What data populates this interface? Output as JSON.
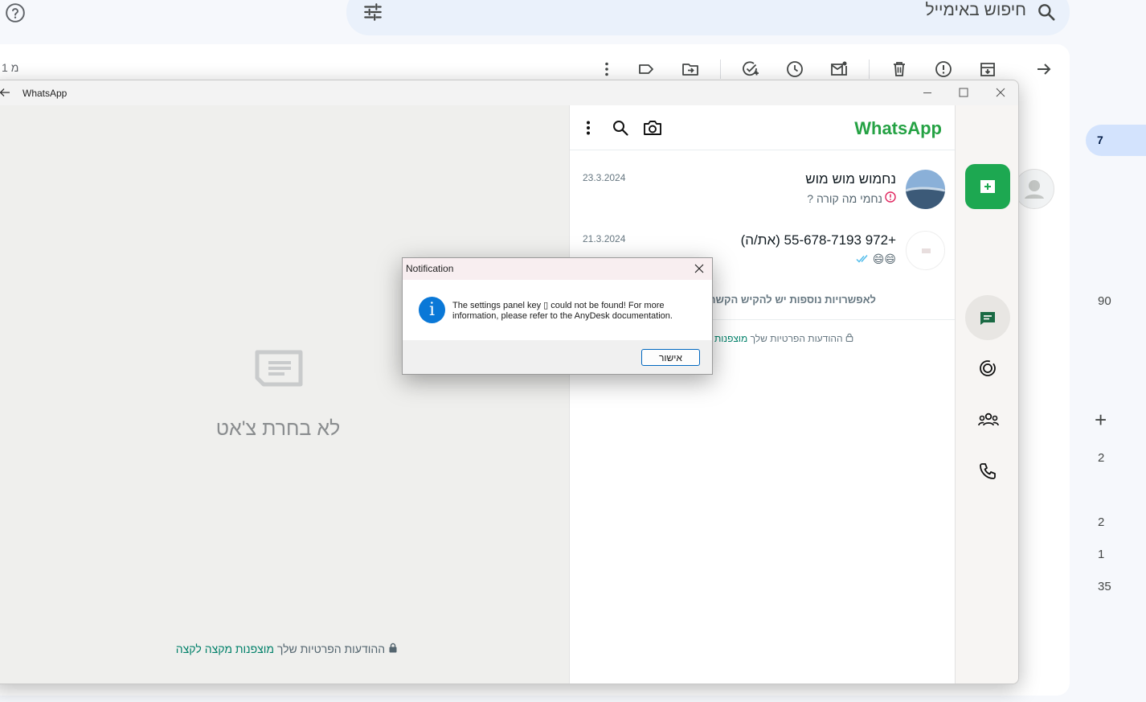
{
  "gmail": {
    "search_placeholder": "חיפוש באימייל",
    "count_label": "1 מ",
    "toolbar_icons": [
      "back-arrow-icon",
      "archive-icon",
      "report-spam-icon",
      "delete-icon",
      "mark-unread-icon",
      "snooze-icon",
      "add-to-tasks-icon",
      "move-to-icon",
      "label-icon",
      "more-vert-icon"
    ],
    "right_rail": {
      "active_count": "7",
      "counts": [
        "90",
        "2",
        "2",
        "1",
        "35"
      ]
    }
  },
  "whatsapp": {
    "window_title": "WhatsApp",
    "logo": "WhatsApp",
    "empty_state": "לא בחרת צ'אט",
    "encrypted_note_prefix": "ההודעות הפרטיות שלך",
    "encrypted_note_link": "מוצפנות מקצה לקצה",
    "encrypted_note_link_short": "מוצפנות",
    "more_options_note": "לאפשרויות נוספות יש להקיש הקשה א",
    "chats": [
      {
        "name": "נחמוש מוש מוש",
        "preview": "נחמי מה קורה ?",
        "date": "23.3.2024"
      },
      {
        "name": "+972 55-678-7193 (את/ה)",
        "preview": "😄😄",
        "date": "21.3.2024"
      }
    ],
    "colors": {
      "brand": "#25a244",
      "new_chat": "#1da851",
      "link": "#008069"
    }
  },
  "dialog": {
    "title": "Notification",
    "message": "The settings panel key ▯ could not be found! For more information, please refer to the AnyDesk documentation.",
    "ok_label": "אישור"
  }
}
